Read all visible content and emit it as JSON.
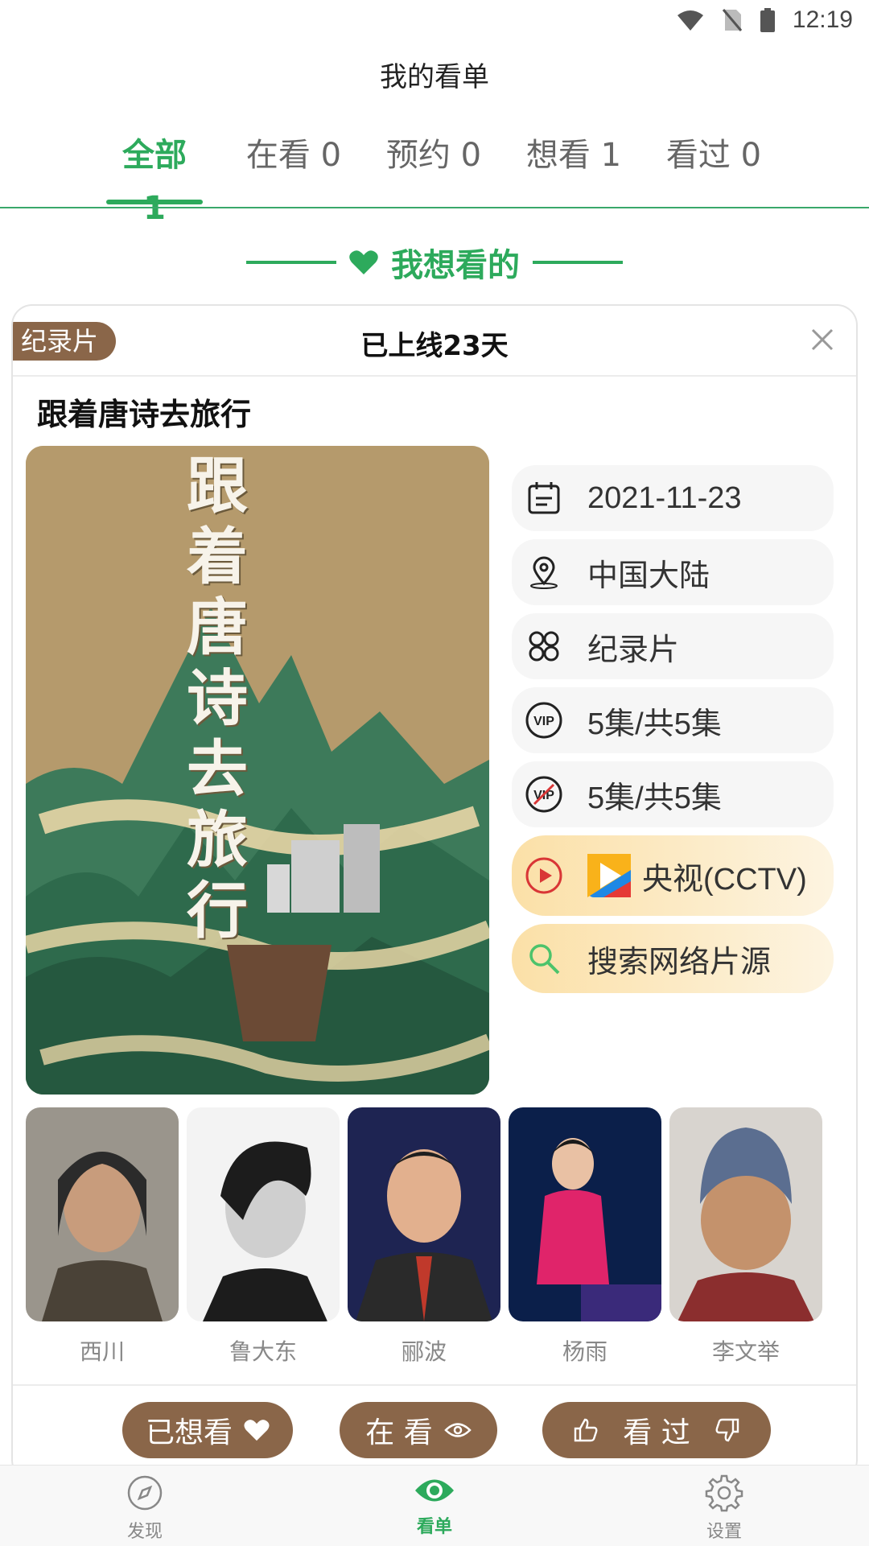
{
  "status_bar": {
    "time": "12:19"
  },
  "header": {
    "title": "我的看单"
  },
  "tabs": [
    {
      "label": "全部 1",
      "active": true
    },
    {
      "label": "在看 0"
    },
    {
      "label": "预约 0"
    },
    {
      "label": "想看 1"
    },
    {
      "label": "看过 0"
    }
  ],
  "section": {
    "title": "我想看的"
  },
  "card": {
    "genre_badge": "纪录片",
    "online_status": "已上线23天",
    "title": "跟着唐诗去旅行",
    "poster_text": "跟着唐诗去旅行",
    "info": {
      "date": "2021-11-23",
      "region": "中国大陆",
      "genre": "纪录片",
      "vip_episodes": "5集/共5集",
      "free_episodes": "5集/共5集",
      "platform": "央视(CCTV)",
      "search": "搜索网络片源"
    },
    "cast": [
      {
        "name": "西川"
      },
      {
        "name": "鲁大东"
      },
      {
        "name": "郦波"
      },
      {
        "name": "杨雨"
      },
      {
        "name": "李文举"
      }
    ],
    "actions": {
      "want": "已想看",
      "watching": "在 看",
      "watched": "看 过"
    }
  },
  "bottom_nav": [
    {
      "label": "发现",
      "icon": "compass-icon"
    },
    {
      "label": "看单",
      "icon": "eye-icon",
      "active": true
    },
    {
      "label": "设置",
      "icon": "gear-icon"
    }
  ],
  "colors": {
    "accent": "#2daa5c",
    "brown": "#8a6649"
  }
}
